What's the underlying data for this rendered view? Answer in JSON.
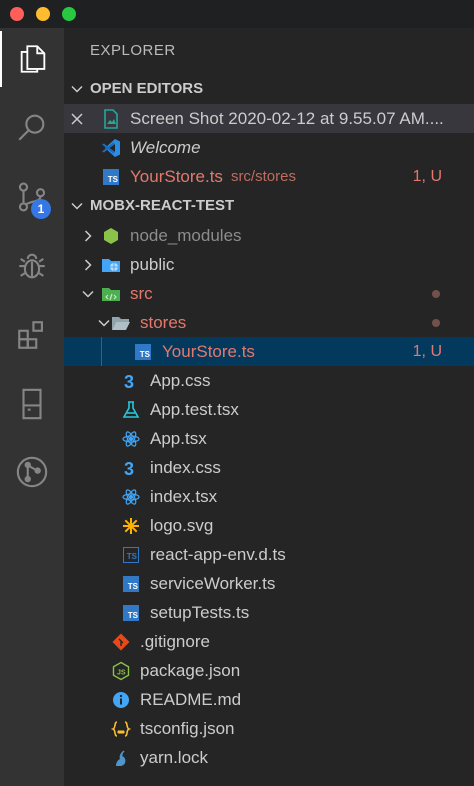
{
  "sidebar": {
    "title": "EXPLORER",
    "scm_badge": "1"
  },
  "open_editors": {
    "label": "OPEN EDITORS",
    "items": [
      {
        "name": "Screen Shot 2020-02-12 at 9.55.07 AM....",
        "desc": "",
        "status": ""
      },
      {
        "name": "Welcome",
        "desc": "",
        "status": ""
      },
      {
        "name": "YourStore.ts",
        "desc": "src/stores",
        "status": "1, U"
      }
    ]
  },
  "workspace": {
    "label": "MOBX-REACT-TEST",
    "folders": {
      "node_modules": "node_modules",
      "public": "public",
      "src": "src",
      "stores": "stores"
    },
    "store_file": {
      "name": "YourStore.ts",
      "status": "1, U"
    },
    "src_files": [
      "App.css",
      "App.test.tsx",
      "App.tsx",
      "index.css",
      "index.tsx",
      "logo.svg",
      "react-app-env.d.ts",
      "serviceWorker.ts",
      "setupTests.ts"
    ],
    "root_files": [
      ".gitignore",
      "package.json",
      "README.md",
      "tsconfig.json",
      "yarn.lock"
    ]
  },
  "colors": {
    "activity_bar": "#333333",
    "sidebar": "#252526",
    "selection": "#04395e",
    "git_untracked": "#e5786d",
    "typescript": "#3178c6"
  }
}
